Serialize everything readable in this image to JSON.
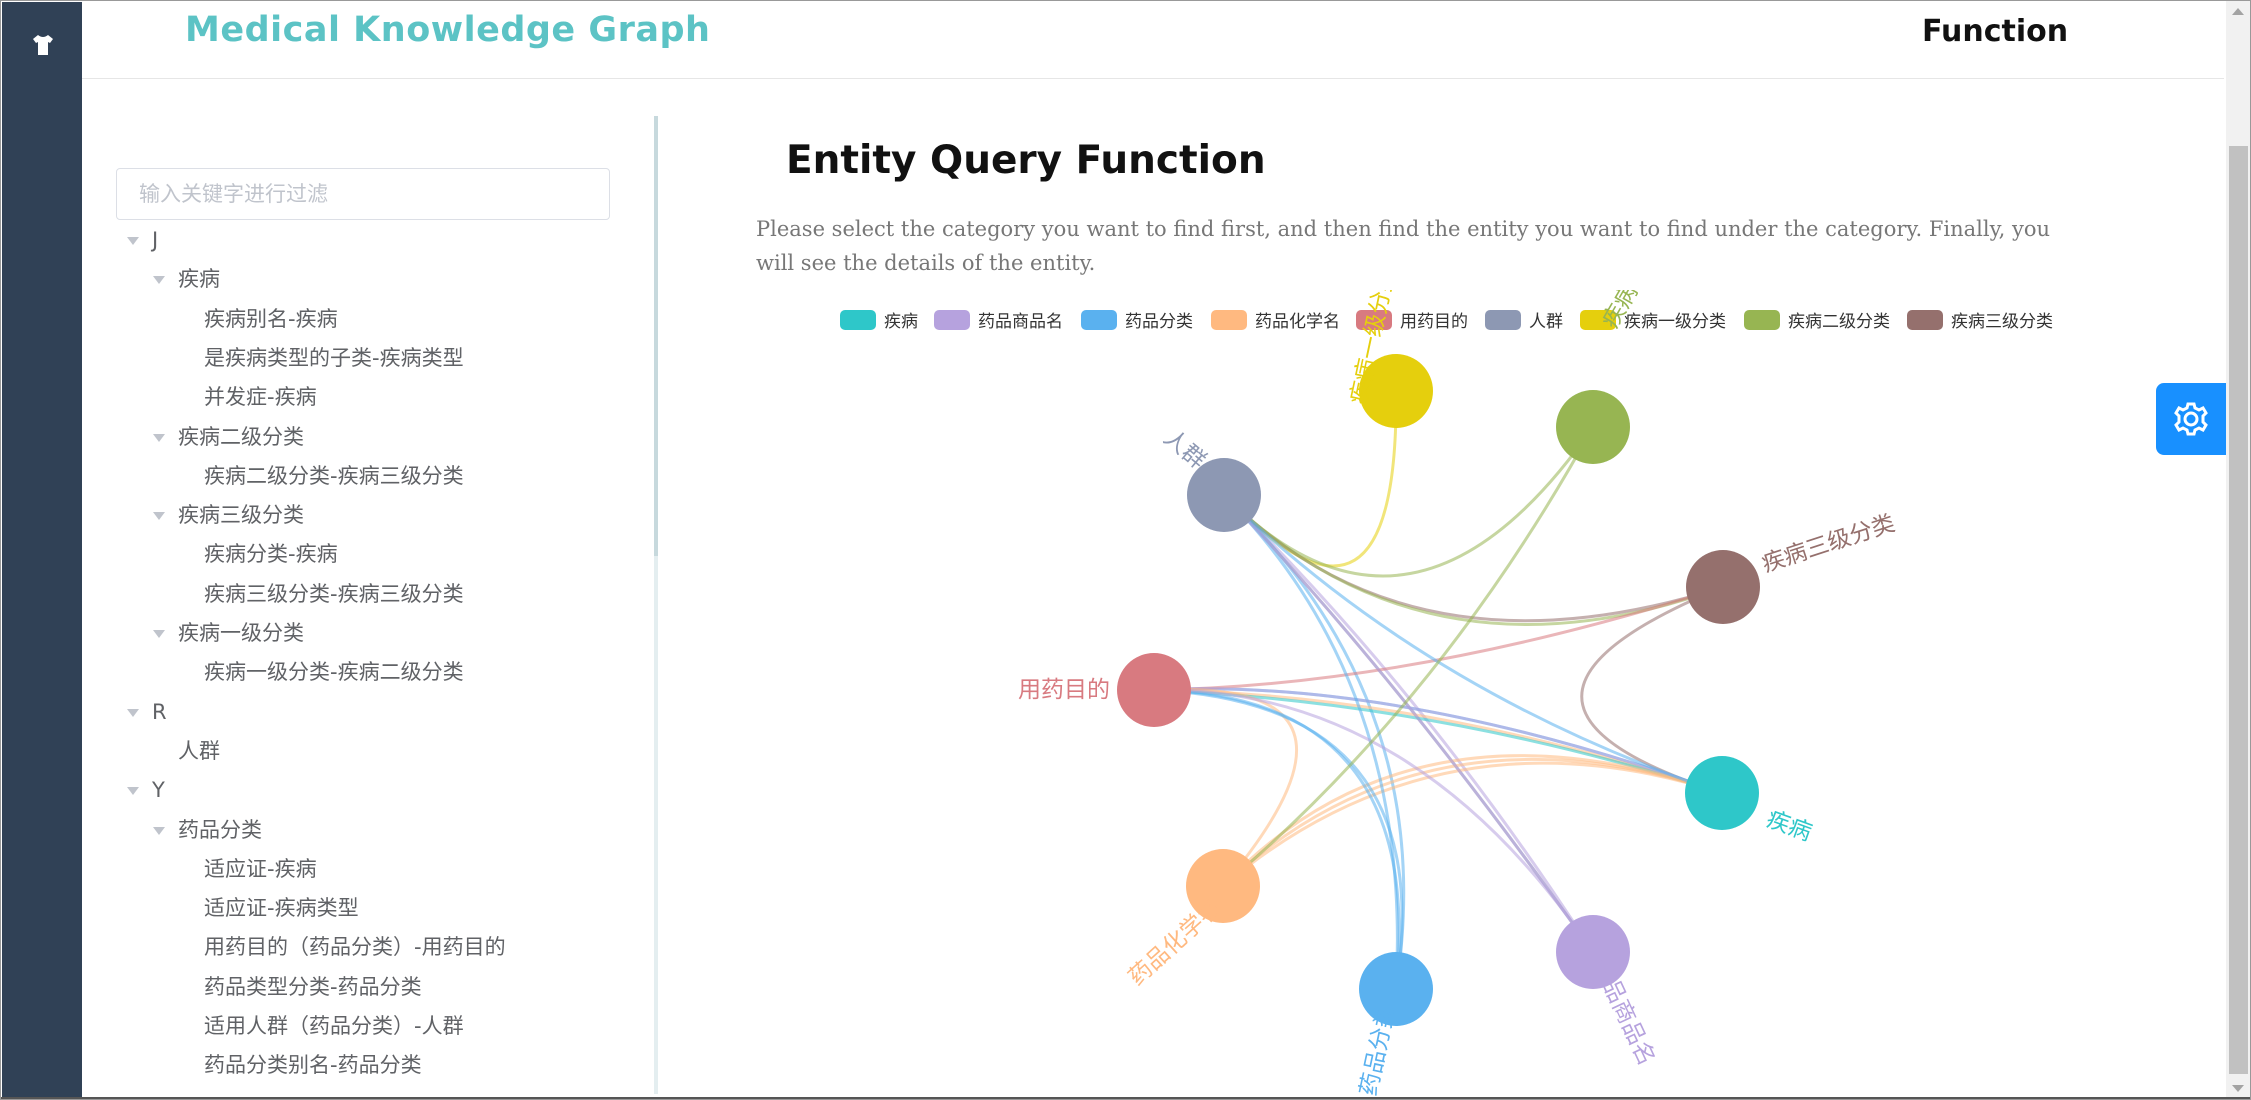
{
  "header": {
    "brand": "Medical Knowledge Graph",
    "function_label": "Function"
  },
  "sidebar": {
    "logo_icon": "shirt-icon"
  },
  "search": {
    "placeholder": "输入关键字进行过滤",
    "value": ""
  },
  "tree": [
    {
      "label": "J",
      "level": 0,
      "expanded": true
    },
    {
      "label": "疾病",
      "level": 1,
      "expanded": true
    },
    {
      "label": "疾病别名-疾病",
      "level": 2
    },
    {
      "label": "是疾病类型的子类-疾病类型",
      "level": 2
    },
    {
      "label": "并发症-疾病",
      "level": 2
    },
    {
      "label": "疾病二级分类",
      "level": 1,
      "expanded": true
    },
    {
      "label": "疾病二级分类-疾病三级分类",
      "level": 2
    },
    {
      "label": "疾病三级分类",
      "level": 1,
      "expanded": true
    },
    {
      "label": "疾病分类-疾病",
      "level": 2
    },
    {
      "label": "疾病三级分类-疾病三级分类",
      "level": 2
    },
    {
      "label": "疾病一级分类",
      "level": 1,
      "expanded": true
    },
    {
      "label": "疾病一级分类-疾病二级分类",
      "level": 2
    },
    {
      "label": "R",
      "level": 0,
      "expanded": true
    },
    {
      "label": "人群",
      "level": 1
    },
    {
      "label": "Y",
      "level": 0,
      "expanded": true
    },
    {
      "label": "药品分类",
      "level": 1,
      "expanded": true
    },
    {
      "label": "适应证-疾病",
      "level": 2
    },
    {
      "label": "适应证-疾病类型",
      "level": 2
    },
    {
      "label": "用药目的（药品分类）-用药目的",
      "level": 2
    },
    {
      "label": "药品类型分类-药品分类",
      "level": 2
    },
    {
      "label": "适用人群（药品分类）-人群",
      "level": 2
    },
    {
      "label": "药品分类别名-药品分类",
      "level": 2
    }
  ],
  "main": {
    "title": "Entity Query Function",
    "description": "Please select the category you want to find first, and then find the entity you want to find under the category. Finally, you will see the details of the entity."
  },
  "graph": {
    "legend": [
      {
        "name": "疾病",
        "color": "#2ec7c9"
      },
      {
        "name": "药品商品名",
        "color": "#b6a2de"
      },
      {
        "name": "药品分类",
        "color": "#5ab1ef"
      },
      {
        "name": "药品化学名",
        "color": "#ffb980"
      },
      {
        "name": "用药目的",
        "color": "#d87a80"
      },
      {
        "name": "人群",
        "color": "#8d98b3"
      },
      {
        "name": "疾病一级分类",
        "color": "#e5cf0d"
      },
      {
        "name": "疾病二级分类",
        "color": "#97b552"
      },
      {
        "name": "疾病三级分类",
        "color": "#95706d"
      }
    ],
    "nodes": [
      {
        "category": "疾病一级分类",
        "label": "疾病一级分类"
      },
      {
        "category": "疾病二级分类",
        "label": "疾病二级分类"
      },
      {
        "category": "人群",
        "label": "人群"
      },
      {
        "category": "疾病三级分类",
        "label": "疾病三级分类"
      },
      {
        "category": "用药目的",
        "label": "用药目的"
      },
      {
        "category": "疾病",
        "label": "疾病"
      },
      {
        "category": "药品化学名",
        "label": "药品化学名"
      },
      {
        "category": "药品分类",
        "label": "药品分类"
      },
      {
        "category": "药品商品名",
        "label": "药品商品名"
      }
    ]
  },
  "settings": {
    "icon": "gear-icon"
  }
}
